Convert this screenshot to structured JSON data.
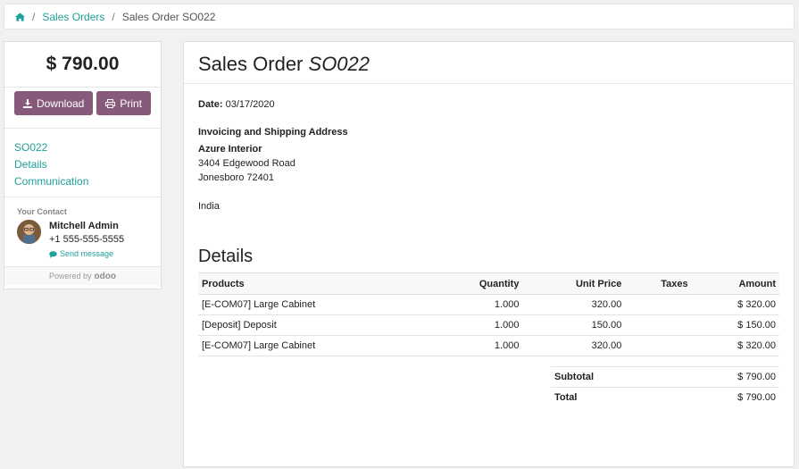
{
  "breadcrumb": {
    "icon": "home-icon",
    "items": [
      {
        "label": "Sales Orders"
      },
      {
        "label": "Sales Order SO022"
      }
    ]
  },
  "sidebar": {
    "amount": "$ 790.00",
    "download_label": "Download",
    "print_label": "Print",
    "nav": [
      {
        "label": "SO022"
      },
      {
        "label": "Details"
      },
      {
        "label": "Communication"
      }
    ],
    "contact": {
      "heading": "Your Contact",
      "name": "Mitchell Admin",
      "phone": "+1 555-555-5555",
      "send_message": "Send message"
    },
    "powered_by": "Powered by",
    "brand": "odoo"
  },
  "main": {
    "title": "Sales Order",
    "number": "SO022",
    "date_label": "Date:",
    "date_value": "03/17/2020",
    "address_title": "Invoicing and Shipping Address",
    "company": "Azure Interior",
    "street": "3404 Edgewood Road",
    "city": "Jonesboro 72401",
    "country": "India",
    "details_title": "Details",
    "table": {
      "headers": [
        "Products",
        "Quantity",
        "Unit Price",
        "Taxes",
        "Amount"
      ],
      "rows": [
        {
          "product": "[E-COM07] Large Cabinet",
          "qty": "1.000",
          "price": "320.00",
          "taxes": "",
          "amount": "$ 320.00"
        },
        {
          "product": "[Deposit] Deposit",
          "qty": "1.000",
          "price": "150.00",
          "taxes": "",
          "amount": "$ 150.00"
        },
        {
          "product": "[E-COM07] Large Cabinet",
          "qty": "1.000",
          "price": "320.00",
          "taxes": "",
          "amount": "$ 320.00"
        }
      ]
    },
    "totals": {
      "subtotal_label": "Subtotal",
      "subtotal_value": "$ 790.00",
      "total_label": "Total",
      "total_value": "$ 790.00"
    }
  },
  "colors": {
    "accent": "#1fa09a",
    "button": "#875a7b"
  }
}
